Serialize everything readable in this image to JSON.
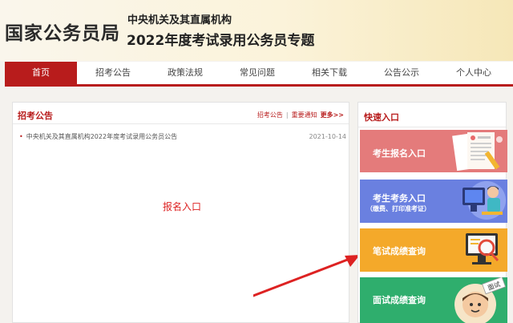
{
  "header": {
    "brand": "国家公务员局",
    "org": "中央机关及其直属机构",
    "topic": "2022年度考试录用公务员专题"
  },
  "nav": {
    "items": [
      {
        "label": "首页",
        "active": true
      },
      {
        "label": "招考公告"
      },
      {
        "label": "政策法规"
      },
      {
        "label": "常见问题"
      },
      {
        "label": "相关下载"
      },
      {
        "label": "公告公示"
      },
      {
        "label": "个人中心"
      }
    ]
  },
  "notices": {
    "title": "招考公告",
    "links": [
      "招考公告",
      "重要通知",
      "更多>>"
    ],
    "items": [
      {
        "title": "中央机关及其直属机构2022年度考试录用公务员公告",
        "date": "2021-10-14"
      }
    ],
    "callout": "报名入口"
  },
  "quick": {
    "title": "快速入口",
    "cards": [
      {
        "label": "考生报名入口",
        "color": "#e47b7b"
      },
      {
        "label": "考生考务入口",
        "sub": "（缴费、打印准考证）",
        "color": "#6a80e0"
      },
      {
        "label": "笔试成绩查询",
        "color": "#f4a92a"
      },
      {
        "label": "面试成绩查询",
        "badge": "面试",
        "color": "#2fae6d"
      }
    ]
  },
  "colors": {
    "accent": "#b81c1c",
    "callout": "#dd2222"
  }
}
